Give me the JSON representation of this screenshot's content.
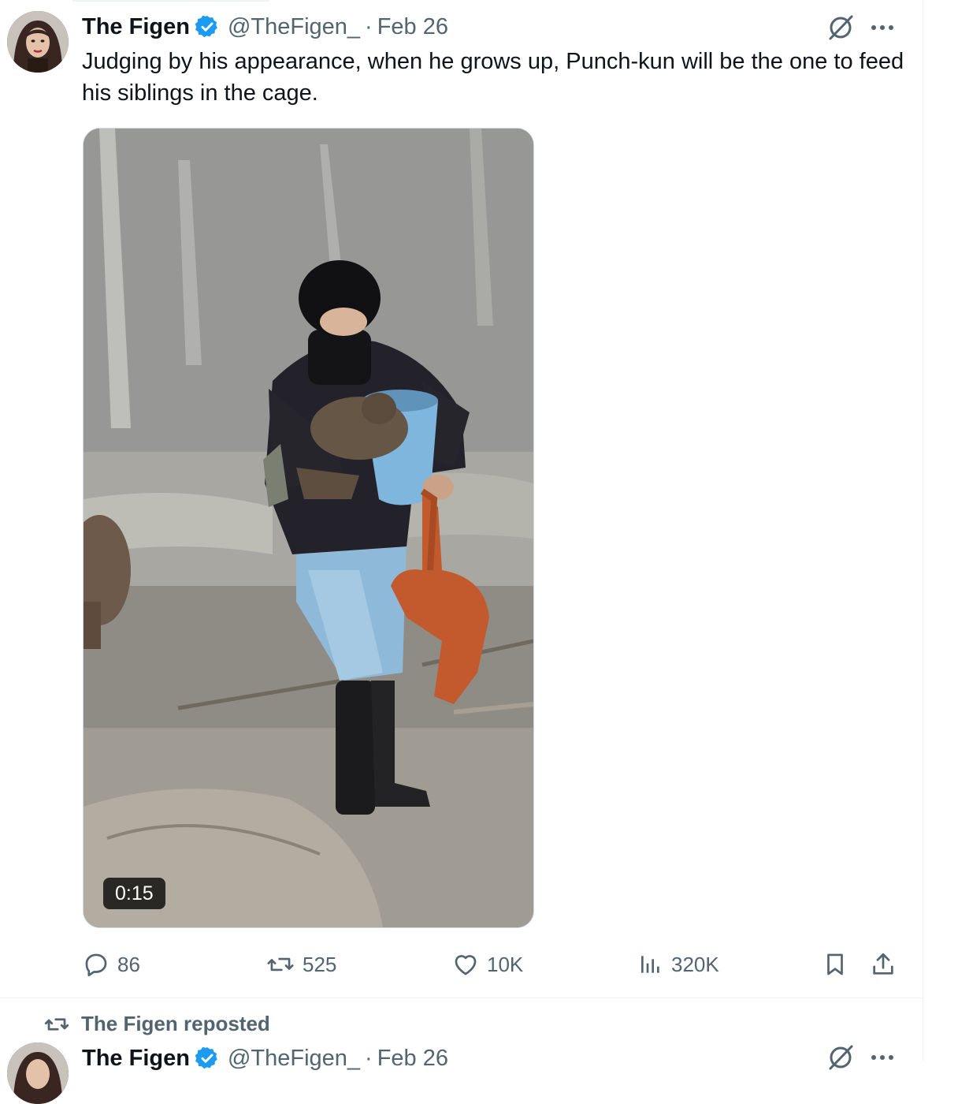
{
  "tweet": {
    "author_name": "The Figen",
    "handle": "@TheFigen_",
    "separator": "·",
    "date": "Feb 26",
    "text": "Judging by his appearance, when he grows up, Punch-kun will be the one to feed his siblings in the cage.",
    "video_duration": "0:15",
    "stats": {
      "replies": "86",
      "reposts": "525",
      "likes": "10K",
      "views": "320K"
    }
  },
  "next_item": {
    "repost_label": "The Figen reposted",
    "author_name": "The Figen",
    "handle": "@TheFigen_",
    "separator": "·",
    "date": "Feb 26"
  },
  "icons": {
    "verified": "verified-badge-icon",
    "grok": "grok-icon",
    "more": "more-icon",
    "reply": "reply-icon",
    "repost": "repost-icon",
    "like": "heart-icon",
    "views": "views-icon",
    "bookmark": "bookmark-icon",
    "share": "share-icon"
  },
  "colors": {
    "text": "#0f1419",
    "secondary": "#536471",
    "verified": "#1d9bf0",
    "border": "#eff3f4"
  }
}
